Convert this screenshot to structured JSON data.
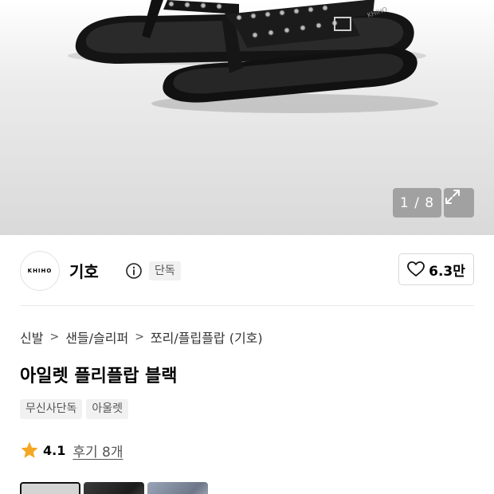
{
  "gallery": {
    "counter": "1 / 8",
    "expand_icon": "expand-icon",
    "brand_print": "KHIHO"
  },
  "brand": {
    "logo_text": "KHIHO",
    "name": "기호",
    "info_icon": "info-icon",
    "exclusive_badge": "단독",
    "like_icon": "heart-outline-icon",
    "like_count": "6.3만"
  },
  "breadcrumb": [
    "신발",
    "샌들/슬리퍼",
    "쪼리/플립플랍 (기호)"
  ],
  "breadcrumb_separator_icon": "chevron-right-icon",
  "product": {
    "title": "아일렛 플리플랍 블랙",
    "tags": [
      "무신사단독",
      "아울렛"
    ]
  },
  "rating": {
    "star_icon": "star-icon",
    "star_color": "#f5a623",
    "value": "4.1",
    "review_link": "후기 8개"
  },
  "thumbnails": [
    "thumbnail-1",
    "thumbnail-2",
    "thumbnail-3"
  ]
}
